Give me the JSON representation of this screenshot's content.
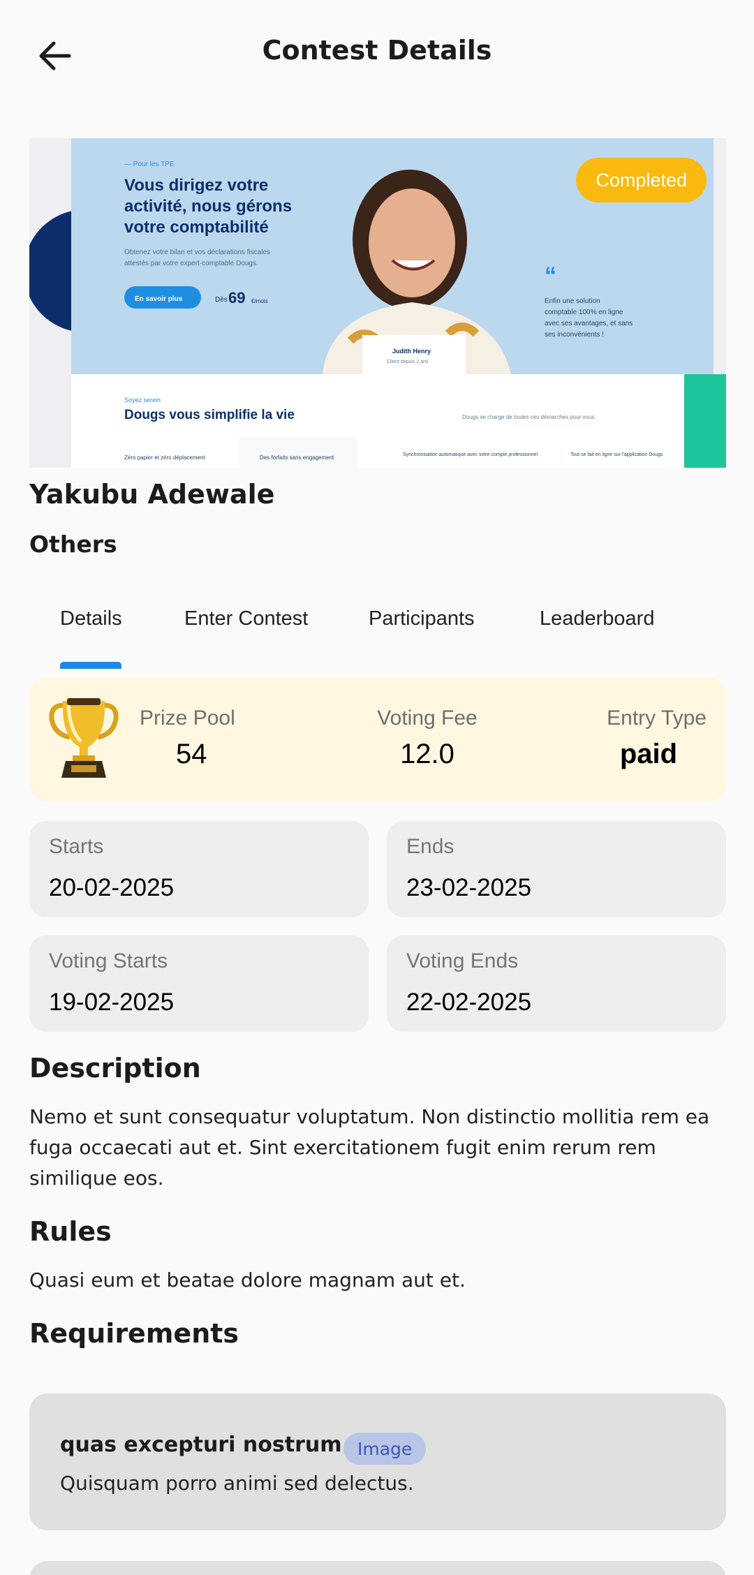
{
  "appbar": {
    "title": "Contest Details",
    "back_icon": "arrow-left-icon"
  },
  "banner": {
    "status_badge": "Completed",
    "status_color": "#f9b90f",
    "image": {
      "kicker": "— Pour les TPE",
      "headline": [
        "Vous dirigez votre",
        "activité, nous gérons",
        "votre comptabilité"
      ],
      "subtext": [
        "Obtenez votre bilan et vos déclarations fiscales",
        "attestés par votre expert-comptable Dougs."
      ],
      "cta": "En savoir plus",
      "price_prefix": "Dès",
      "price": "69",
      "price_suffix": "€/mois",
      "quote": [
        "Enfin une solution",
        "comptable 100% en ligne",
        "avec ses avantages, et sans",
        "ses inconvénients !"
      ],
      "person_name": "Judith Henry",
      "person_caption": "Client depuis 2 ans",
      "section_kicker": "Soyez serein",
      "section_heading": "Dougs vous simplifie la vie",
      "section_right": "Dougs se charge de toutes ces démarches pour vous.",
      "features": [
        "Zéro papier et zéro déplacement",
        "Des forfaits sans engagement",
        "Synchronisation automatique avec votre compte professionnel",
        "Tout se fait en ligne sur l'application Dougs"
      ]
    }
  },
  "owner": {
    "name": "Yakubu Adewale",
    "category": "Others"
  },
  "tabs": [
    {
      "label": "Details",
      "active": true
    },
    {
      "label": "Enter Contest",
      "active": false
    },
    {
      "label": "Participants",
      "active": false
    },
    {
      "label": "Leaderboard",
      "active": false
    }
  ],
  "tab_accent": "#1e88e5",
  "prize": {
    "icon": "trophy-icon",
    "prize_pool_label": "Prize Pool",
    "prize_pool_value": "54",
    "voting_fee_label": "Voting Fee",
    "voting_fee_value": "12.0",
    "entry_type_label": "Entry Type",
    "entry_type_value": "paid"
  },
  "dates": {
    "starts_label": "Starts",
    "starts_value": "20-02-2025",
    "ends_label": "Ends",
    "ends_value": "23-02-2025",
    "voting_starts_label": "Voting Starts",
    "voting_starts_value": "19-02-2025",
    "voting_ends_label": "Voting Ends",
    "voting_ends_value": "22-02-2025"
  },
  "description": {
    "title": "Description",
    "lines": [
      "Nemo et sunt consequatur voluptatum. Non distinctio mollitia rem ea",
      "fuga occaecati aut et. Sint exercitationem fugit enim rerum rem",
      "similique eos."
    ]
  },
  "rules": {
    "title": "Rules",
    "text": "Quasi eum et beatae dolore magnam aut et."
  },
  "requirements": {
    "title": "Requirements",
    "items": [
      {
        "name": "quas excepturi nostrum",
        "type": "Image",
        "description": "Quisquam porro animi sed delectus."
      }
    ]
  }
}
